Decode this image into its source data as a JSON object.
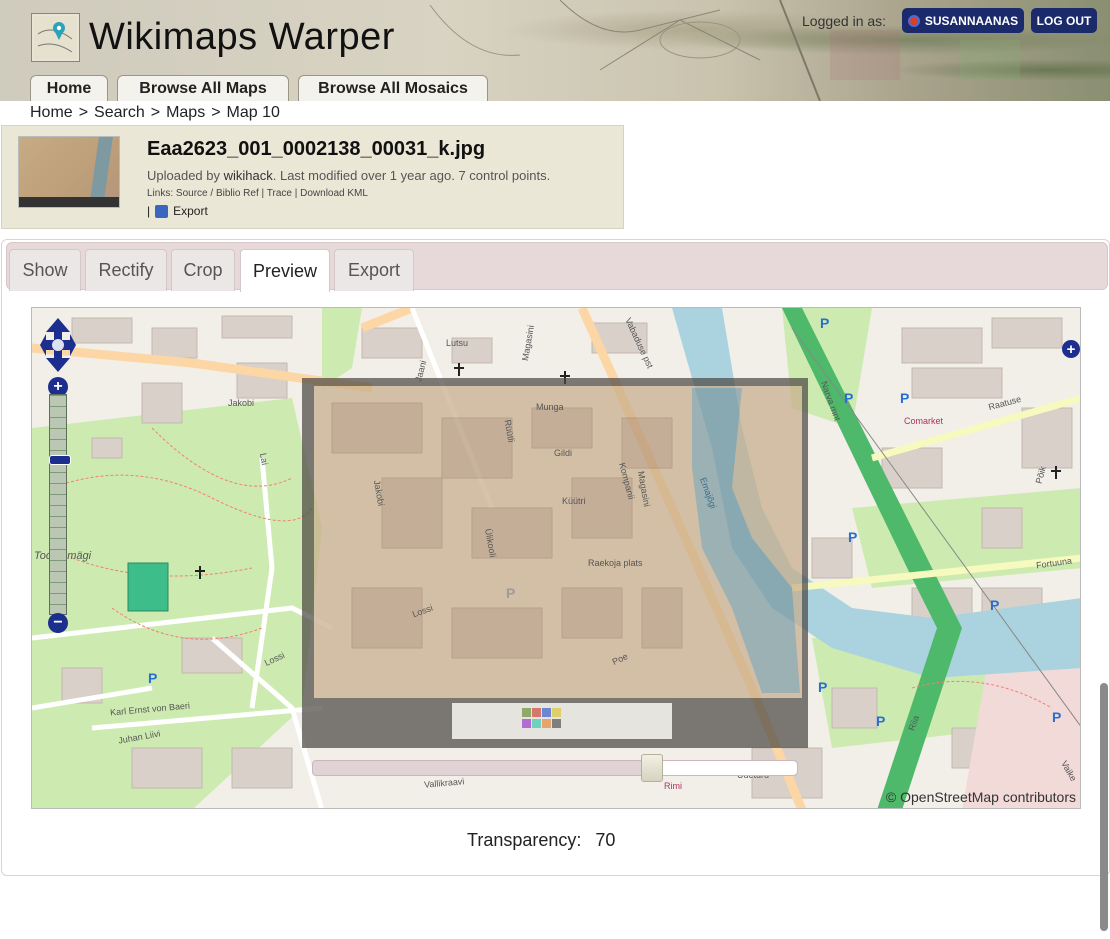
{
  "header": {
    "site_title": "Wikimaps Warper",
    "logged_in_label": "Logged in as:",
    "user_name": "SUSANNAANAS",
    "logout_label": "LOG OUT",
    "nav_tabs": [
      "Home",
      "Browse All Maps",
      "Browse All Mosaics"
    ]
  },
  "breadcrumb": [
    "Home",
    ">",
    "Search",
    ">",
    "Maps",
    ">",
    "Map 10"
  ],
  "map_info": {
    "title": "Eaa2623_001_0002138_00031_k.jpg",
    "uploaded_prefix": "Uploaded by",
    "uploader": "wikihack",
    "uploaded_suffix": ". Last modified over 1 year ago. 7 control points.",
    "links_label": "Links:",
    "links": [
      "Source",
      "/",
      "Biblio Ref",
      "|",
      "Trace",
      "|",
      "Download KML"
    ],
    "export_separator": "|",
    "export_label": "Export"
  },
  "tabs": [
    "Show",
    "Rectify",
    "Crop",
    "Preview",
    "Export"
  ],
  "active_tab": "Preview",
  "map": {
    "attribution": "© OpenStreetMap contributors",
    "labels": [
      "Jakobi",
      "Lutsu",
      "Jaani",
      "Magasini",
      "Vabaduse pst",
      "Munga",
      "Rüütli",
      "Gildi",
      "Kompanii",
      "Magasini",
      "Küütri",
      "Emajõgi",
      "Raekoja plats",
      "Uueturu",
      "Poe",
      "Lossi",
      "Lossi",
      "Karl Ernst von Baeri",
      "Juhan Liivi",
      "Vallikraavi",
      "Rimi",
      "Comarket",
      "Raatuse",
      "Narva mnt",
      "Fortuuna",
      "Riia",
      "Põik",
      "Vaike",
      "Toomemägi",
      "Lai",
      "Ülikooli",
      "Jakobi"
    ],
    "overlay_transparency_percent": 70
  },
  "transparency": {
    "label": "Transparency:",
    "value": "70"
  },
  "colors": {
    "header_button": "#1b2a6b",
    "map_park": "#cdebb0",
    "map_road_primary": "#fcd6a4",
    "map_river": "#aad3df",
    "control_blue": "#1c2f8f"
  }
}
